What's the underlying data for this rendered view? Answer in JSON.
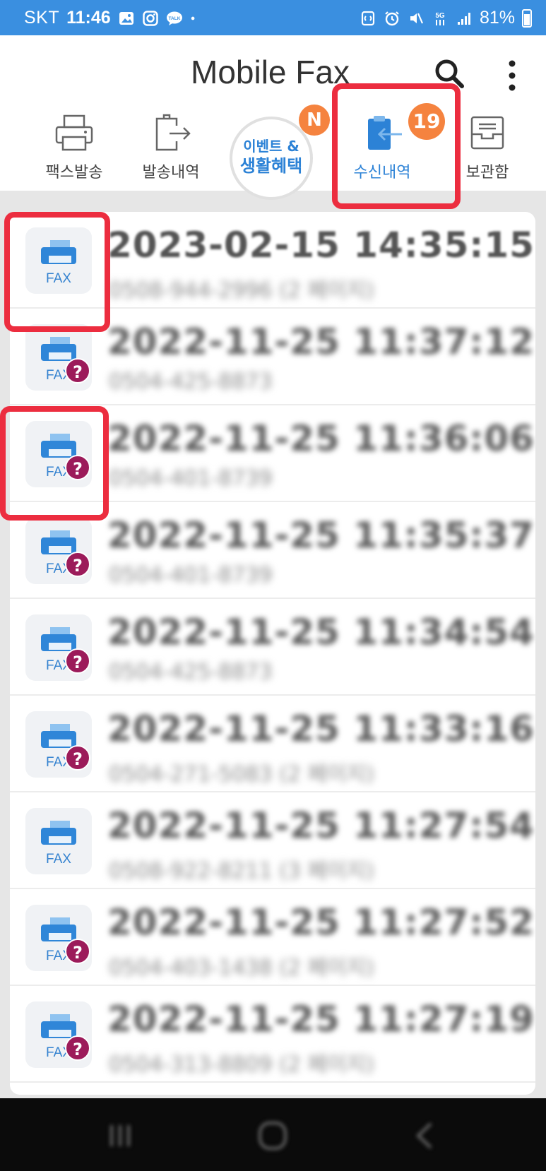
{
  "status_bar": {
    "carrier": "SKT",
    "time": "11:46",
    "battery": "81%",
    "icons": [
      "gallery-icon",
      "instagram-icon",
      "kakaotalk-icon",
      "dot-icon",
      "nfc-icon",
      "alarm-icon",
      "mute-icon",
      "5g-icon",
      "signal-icon",
      "battery-icon"
    ]
  },
  "header": {
    "title": "Mobile Fax"
  },
  "tabs": [
    {
      "label": "팩스발송",
      "icon": "printer-icon"
    },
    {
      "label": "발송내역",
      "icon": "outbox-icon"
    },
    {
      "label": "수신내역",
      "icon": "inbox-icon",
      "active": true,
      "badge": "19"
    },
    {
      "label": "보관함",
      "icon": "archive-icon"
    }
  ],
  "event": {
    "line1": "이벤트 &",
    "line2": "생활혜택",
    "badge": "N"
  },
  "fax_label": "FAX",
  "unknown_badge": "?",
  "list": [
    {
      "date": "2023-02-15 14:35:15",
      "phone": "0508-944-2996 (2 페이지)",
      "unknown": false
    },
    {
      "date": "2022-11-25 11:37:12",
      "phone": "0504-425-8873",
      "unknown": true
    },
    {
      "date": "2022-11-25 11:36:06",
      "phone": "0504-401-8739",
      "unknown": true
    },
    {
      "date": "2022-11-25 11:35:37",
      "phone": "0504-401-8739",
      "unknown": true
    },
    {
      "date": "2022-11-25 11:34:54",
      "phone": "0504-425-8873",
      "unknown": true
    },
    {
      "date": "2022-11-25 11:33:16",
      "phone": "0504-271-5083 (2 페이지)",
      "unknown": true
    },
    {
      "date": "2022-11-25 11:27:54",
      "phone": "0508-922-8211 (3 페이지)",
      "unknown": false
    },
    {
      "date": "2022-11-25 11:27:52",
      "phone": "0504-403-1438 (2 페이지)",
      "unknown": true
    },
    {
      "date": "2022-11-25 11:27:19",
      "phone": "0504-313-8809 (2 페이지)",
      "unknown": true
    }
  ],
  "colors": {
    "status_bar": "#3a8fe0",
    "accent": "#2c82d6",
    "badge": "#f5833f",
    "highlight": "#ec2d3f",
    "unknown_badge": "#9c1b5a"
  }
}
